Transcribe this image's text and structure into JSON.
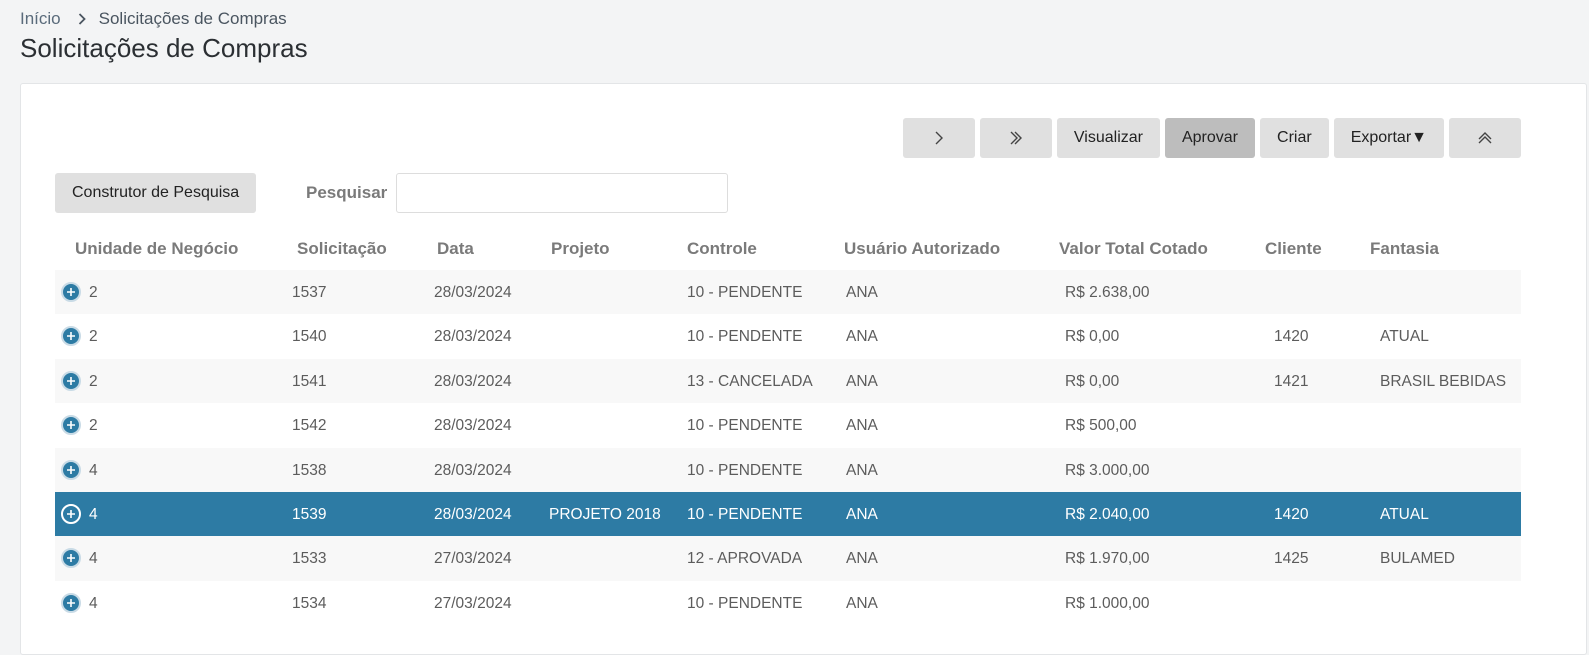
{
  "breadcrumb": {
    "home": "Início",
    "current": "Solicitações de Compras"
  },
  "page_title": "Solicitações de Compras",
  "toolbar": {
    "next_icon": "chevron-right-icon",
    "last_icon": "double-chevron-right-icon",
    "visualizar": "Visualizar",
    "aprovar": "Aprovar",
    "criar": "Criar",
    "exportar": "Exportar▼",
    "collapse_icon": "double-chevron-up-icon"
  },
  "search": {
    "builder_label": "Construtor de Pesquisa",
    "label": "Pesquisar",
    "value": ""
  },
  "table": {
    "headers": [
      "Unidade de Negócio",
      "Solicitação",
      "Data",
      "Projeto",
      "Controle",
      "Usuário Autorizado",
      "Valor Total Cotado",
      "Cliente",
      "Fantasia"
    ],
    "rows": [
      [
        "2",
        "1537",
        "28/03/2024",
        "",
        "10 - PENDENTE",
        "ANA",
        "R$ 2.638,00",
        "",
        ""
      ],
      [
        "2",
        "1540",
        "28/03/2024",
        "",
        "10 - PENDENTE",
        "ANA",
        "R$ 0,00",
        "1420",
        "ATUAL"
      ],
      [
        "2",
        "1541",
        "28/03/2024",
        "",
        "13 - CANCELADA",
        "ANA",
        "R$ 0,00",
        "1421",
        "BRASIL BEBIDAS"
      ],
      [
        "2",
        "1542",
        "28/03/2024",
        "",
        "10 - PENDENTE",
        "ANA",
        "R$ 500,00",
        "",
        ""
      ],
      [
        "4",
        "1538",
        "28/03/2024",
        "",
        "10 - PENDENTE",
        "ANA",
        "R$ 3.000,00",
        "",
        ""
      ],
      [
        "4",
        "1539",
        "28/03/2024",
        "PROJETO 2018",
        "10 - PENDENTE",
        "ANA",
        "R$ 2.040,00",
        "1420",
        "ATUAL"
      ],
      [
        "4",
        "1533",
        "27/03/2024",
        "",
        "12 - APROVADA",
        "ANA",
        "R$ 1.970,00",
        "1425",
        "BULAMED"
      ],
      [
        "4",
        "1534",
        "27/03/2024",
        "",
        "10 - PENDENTE",
        "ANA",
        "R$ 1.000,00",
        "",
        ""
      ]
    ],
    "selected_row": 5,
    "expand_icon": "plus-circle-icon"
  },
  "colors": {
    "accent": "#2d7ba4",
    "button": "#e0e0e0",
    "button_active": "#bdbdbd"
  }
}
